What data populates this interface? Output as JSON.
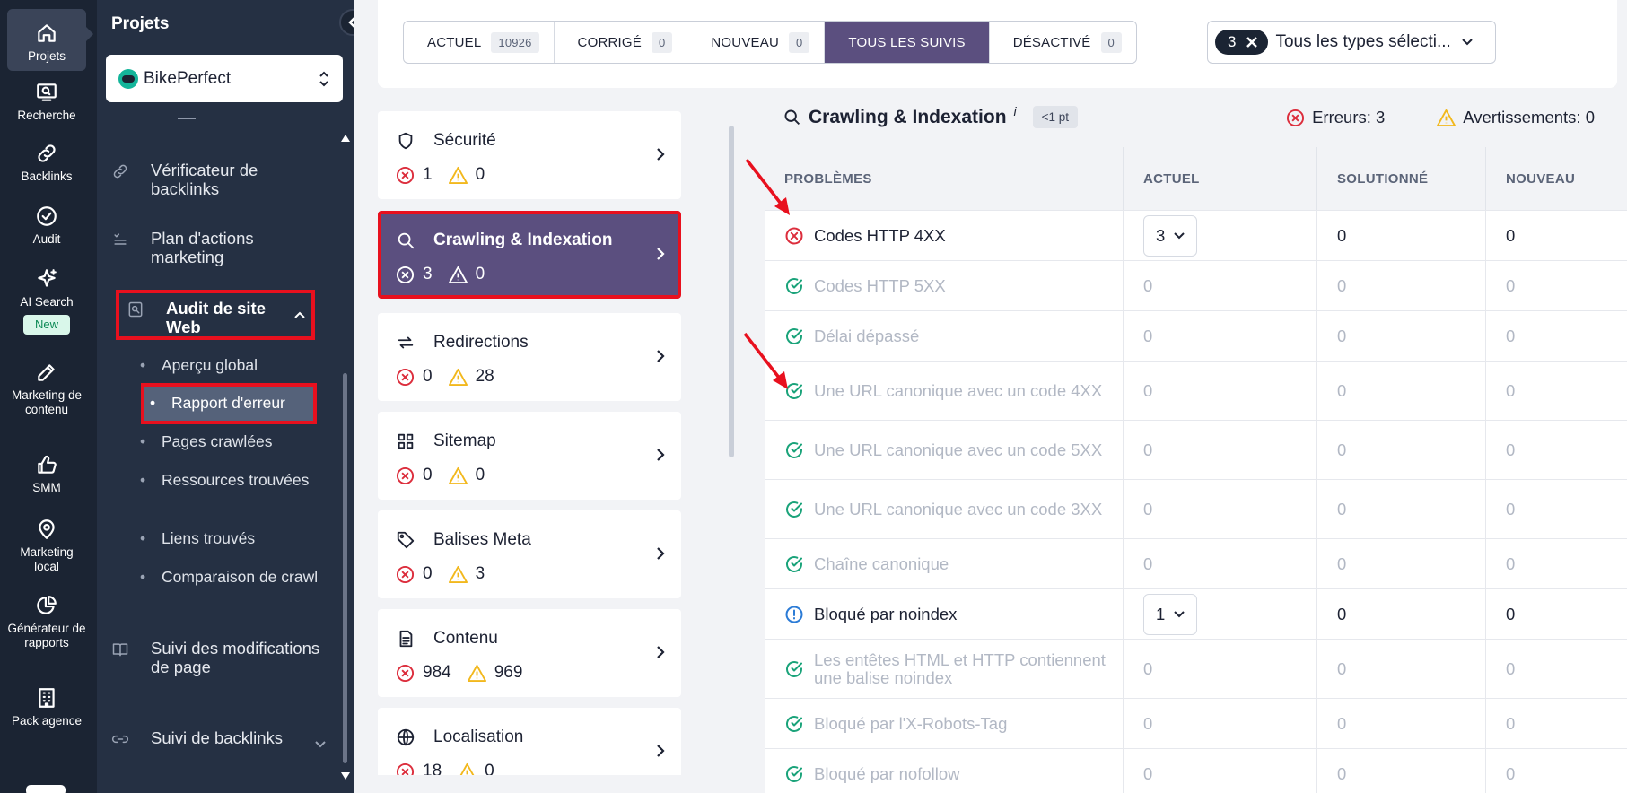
{
  "rail": {
    "items": [
      {
        "label": "Projets",
        "icon": "home-icon"
      },
      {
        "label": "Recherche",
        "icon": "search-screen-icon"
      },
      {
        "label": "Backlinks",
        "icon": "link-icon"
      },
      {
        "label": "Audit",
        "icon": "check-circle-icon"
      },
      {
        "label": "AI Search",
        "icon": "sparkle-icon",
        "badge": "New"
      },
      {
        "label": "Marketing de contenu",
        "icon": "edit-icon"
      },
      {
        "label": "SMM",
        "icon": "thumbs-up-icon"
      },
      {
        "label": "Marketing local",
        "icon": "map-pin-icon"
      },
      {
        "label": "Générateur de rapports",
        "icon": "pie-chart-icon"
      },
      {
        "label": "Pack agence",
        "icon": "building-icon"
      }
    ],
    "badge_color": "#0c8a55"
  },
  "panel": {
    "title": "Projets",
    "project": "BikePerfect",
    "nav": {
      "backlink_checker": "Vérificateur de backlinks",
      "marketing_plan": "Plan d'actions marketing",
      "site_audit": "Audit de site Web",
      "page_tracking": "Suivi des modifications de page",
      "backlink_tracking": "Suivi de backlinks"
    },
    "sub": {
      "overview": "Aperçu global",
      "error_report": "Rapport d'erreur",
      "crawled_pages": "Pages crawlées",
      "resources": "Ressources trouvées",
      "links": "Liens trouvés",
      "crawl_compare": "Comparaison de crawl"
    }
  },
  "filters": {
    "tabs": [
      {
        "label": "ACTUEL",
        "count": "10926"
      },
      {
        "label": "CORRIGÉ",
        "count": "0"
      },
      {
        "label": "NOUVEAU",
        "count": "0"
      },
      {
        "label": "TOUS LES SUIVIS",
        "count": null
      },
      {
        "label": "DÉSACTIVÉ",
        "count": "0"
      }
    ],
    "selected_tab": "TOUS LES SUIVIS",
    "type_chip": "3",
    "type_label": "Tous les types sélecti...",
    "accent": "#5b4f7f"
  },
  "categories": [
    {
      "title": "Sécurité",
      "errors": "1",
      "warnings": "0",
      "icon": "shield-icon"
    },
    {
      "title": "Crawling & Indexation",
      "errors": "3",
      "warnings": "0",
      "icon": "search-icon",
      "selected": true
    },
    {
      "title": "Redirections",
      "errors": "0",
      "warnings": "28",
      "icon": "redirect-icon"
    },
    {
      "title": "Sitemap",
      "errors": "0",
      "warnings": "0",
      "icon": "grid-icon"
    },
    {
      "title": "Balises Meta",
      "errors": "0",
      "warnings": "3",
      "icon": "tag-icon"
    },
    {
      "title": "Contenu",
      "errors": "984",
      "warnings": "969",
      "icon": "document-icon"
    },
    {
      "title": "Localisation",
      "errors": "18",
      "warnings": "0",
      "icon": "globe-icon"
    }
  ],
  "table": {
    "title": "Crawling & Indexation",
    "info": "i",
    "points": "<1 pt",
    "errors_label": "Erreurs: 3",
    "warnings_label": "Avertissements: 0",
    "columns": [
      "PROBLÈMES",
      "ACTUEL",
      "SOLUTIONNÉ",
      "NOUVEAU"
    ],
    "rows": [
      {
        "name": "Codes HTTP 4XX",
        "status": "error",
        "current": "3",
        "dropdown": true,
        "solved": "0",
        "new": "0"
      },
      {
        "name": "Codes HTTP 5XX",
        "status": "ok",
        "current": "0",
        "solved": "0",
        "new": "0"
      },
      {
        "name": "Délai dépassé",
        "status": "ok",
        "current": "0",
        "solved": "0",
        "new": "0"
      },
      {
        "name": "Une URL canonique avec un code 4XX",
        "status": "ok",
        "current": "0",
        "solved": "0",
        "new": "0"
      },
      {
        "name": "Une URL canonique avec un code 5XX",
        "status": "ok",
        "current": "0",
        "solved": "0",
        "new": "0"
      },
      {
        "name": "Une URL canonique avec un code 3XX",
        "status": "ok",
        "current": "0",
        "solved": "0",
        "new": "0"
      },
      {
        "name": "Chaîne canonique",
        "status": "ok",
        "current": "0",
        "solved": "0",
        "new": "0"
      },
      {
        "name": "Bloqué par noindex",
        "status": "notice",
        "current": "1",
        "dropdown": true,
        "solved": "0",
        "new": "0"
      },
      {
        "name": "Les entêtes HTML et HTTP contiennent une balise noindex",
        "status": "ok",
        "current": "0",
        "solved": "0",
        "new": "0"
      },
      {
        "name": "Bloqué par l'X-Robots-Tag",
        "status": "ok",
        "current": "0",
        "solved": "0",
        "new": "0"
      },
      {
        "name": "Bloqué par nofollow",
        "status": "ok",
        "current": "0",
        "solved": "0",
        "new": "0"
      }
    ],
    "colors": {
      "error": "#dc2d3c",
      "warning": "#f2b81d",
      "ok": "#1aa37a",
      "notice": "#2b7bd6"
    }
  }
}
